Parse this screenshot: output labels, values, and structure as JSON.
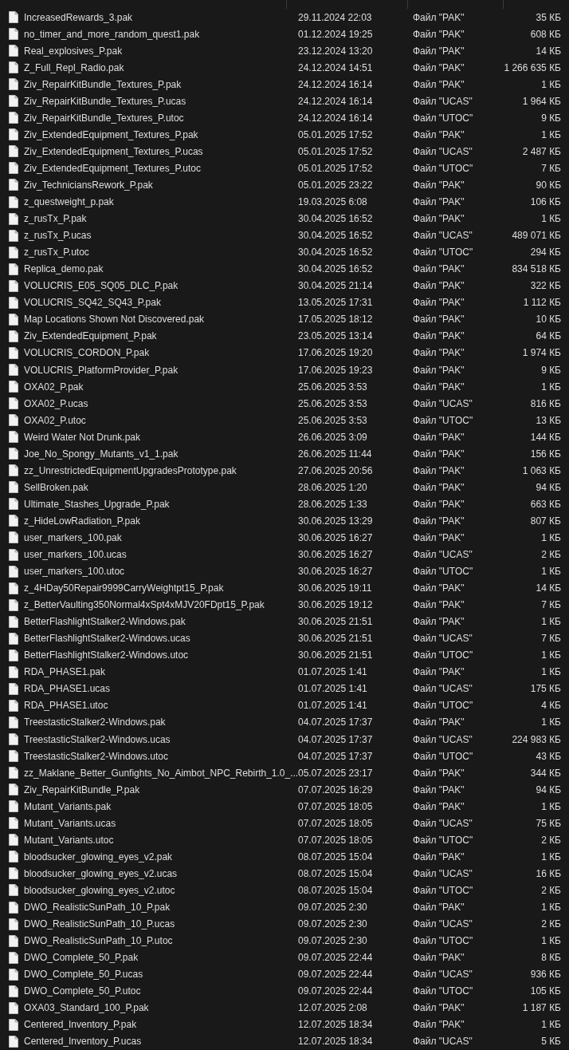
{
  "files": [
    {
      "name": "IncreasedRewards_3.pak",
      "modified": "29.11.2024 22:03",
      "type": "Файл \"PAK\"",
      "size": "35 КБ"
    },
    {
      "name": "no_timer_and_more_random_quest1.pak",
      "modified": "01.12.2024 19:25",
      "type": "Файл \"PAK\"",
      "size": "608 КБ"
    },
    {
      "name": "Real_explosives_P.pak",
      "modified": "23.12.2024 13:20",
      "type": "Файл \"PAK\"",
      "size": "14 КБ"
    },
    {
      "name": "Z_Full_Repl_Radio.pak",
      "modified": "24.12.2024 14:51",
      "type": "Файл \"PAK\"",
      "size": "1 266 635 КБ"
    },
    {
      "name": "Ziv_RepairKitBundle_Textures_P.pak",
      "modified": "24.12.2024 16:14",
      "type": "Файл \"PAK\"",
      "size": "1 КБ"
    },
    {
      "name": "Ziv_RepairKitBundle_Textures_P.ucas",
      "modified": "24.12.2024 16:14",
      "type": "Файл \"UCAS\"",
      "size": "1 964 КБ"
    },
    {
      "name": "Ziv_RepairKitBundle_Textures_P.utoc",
      "modified": "24.12.2024 16:14",
      "type": "Файл \"UTOC\"",
      "size": "9 КБ"
    },
    {
      "name": "Ziv_ExtendedEquipment_Textures_P.pak",
      "modified": "05.01.2025 17:52",
      "type": "Файл \"PAK\"",
      "size": "1 КБ"
    },
    {
      "name": "Ziv_ExtendedEquipment_Textures_P.ucas",
      "modified": "05.01.2025 17:52",
      "type": "Файл \"UCAS\"",
      "size": "2 487 КБ"
    },
    {
      "name": "Ziv_ExtendedEquipment_Textures_P.utoc",
      "modified": "05.01.2025 17:52",
      "type": "Файл \"UTOC\"",
      "size": "7 КБ"
    },
    {
      "name": "Ziv_TechniciansRework_P.pak",
      "modified": "05.01.2025 23:22",
      "type": "Файл \"PAK\"",
      "size": "90 КБ"
    },
    {
      "name": "z_questweight_p.pak",
      "modified": "19.03.2025 6:08",
      "type": "Файл \"PAK\"",
      "size": "106 КБ"
    },
    {
      "name": "z_rusTx_P.pak",
      "modified": "30.04.2025 16:52",
      "type": "Файл \"PAK\"",
      "size": "1 КБ"
    },
    {
      "name": "z_rusTx_P.ucas",
      "modified": "30.04.2025 16:52",
      "type": "Файл \"UCAS\"",
      "size": "489 071 КБ"
    },
    {
      "name": "z_rusTx_P.utoc",
      "modified": "30.04.2025 16:52",
      "type": "Файл \"UTOC\"",
      "size": "294 КБ"
    },
    {
      "name": "Replica_demo.pak",
      "modified": "30.04.2025 16:52",
      "type": "Файл \"PAK\"",
      "size": "834 518 КБ"
    },
    {
      "name": "VOLUCRIS_E05_SQ05_DLC_P.pak",
      "modified": "30.04.2025 21:14",
      "type": "Файл \"PAK\"",
      "size": "322 КБ"
    },
    {
      "name": "VOLUCRIS_SQ42_SQ43_P.pak",
      "modified": "13.05.2025 17:31",
      "type": "Файл \"PAK\"",
      "size": "1 112 КБ"
    },
    {
      "name": "Map Locations Shown Not Discovered.pak",
      "modified": "17.05.2025 18:12",
      "type": "Файл \"PAK\"",
      "size": "10 КБ"
    },
    {
      "name": "Ziv_ExtendedEquipment_P.pak",
      "modified": "23.05.2025 13:14",
      "type": "Файл \"PAK\"",
      "size": "64 КБ"
    },
    {
      "name": "VOLUCRIS_CORDON_P.pak",
      "modified": "17.06.2025 19:20",
      "type": "Файл \"PAK\"",
      "size": "1 974 КБ"
    },
    {
      "name": "VOLUCRIS_PlatformProvider_P.pak",
      "modified": "17.06.2025 19:23",
      "type": "Файл \"PAK\"",
      "size": "9 КБ"
    },
    {
      "name": "OXA02_P.pak",
      "modified": "25.06.2025 3:53",
      "type": "Файл \"PAK\"",
      "size": "1 КБ"
    },
    {
      "name": "OXA02_P.ucas",
      "modified": "25.06.2025 3:53",
      "type": "Файл \"UCAS\"",
      "size": "816 КБ"
    },
    {
      "name": "OXA02_P.utoc",
      "modified": "25.06.2025 3:53",
      "type": "Файл \"UTOC\"",
      "size": "13 КБ"
    },
    {
      "name": "Weird Water Not Drunk.pak",
      "modified": "26.06.2025 3:09",
      "type": "Файл \"PAK\"",
      "size": "144 КБ"
    },
    {
      "name": "Joe_No_Spongy_Mutants_v1_1.pak",
      "modified": "26.06.2025 11:44",
      "type": "Файл \"PAK\"",
      "size": "156 КБ"
    },
    {
      "name": "zz_UnrestrictedEquipmentUpgradesPrototype.pak",
      "modified": "27.06.2025 20:56",
      "type": "Файл \"PAK\"",
      "size": "1 063 КБ"
    },
    {
      "name": "SellBroken.pak",
      "modified": "28.06.2025 1:20",
      "type": "Файл \"PAK\"",
      "size": "94 КБ"
    },
    {
      "name": "Ultimate_Stashes_Upgrade_P.pak",
      "modified": "28.06.2025 1:33",
      "type": "Файл \"PAK\"",
      "size": "663 КБ"
    },
    {
      "name": "z_HideLowRadiation_P.pak",
      "modified": "30.06.2025 13:29",
      "type": "Файл \"PAK\"",
      "size": "807 КБ"
    },
    {
      "name": "user_markers_100.pak",
      "modified": "30.06.2025 16:27",
      "type": "Файл \"PAK\"",
      "size": "1 КБ"
    },
    {
      "name": "user_markers_100.ucas",
      "modified": "30.06.2025 16:27",
      "type": "Файл \"UCAS\"",
      "size": "2 КБ"
    },
    {
      "name": "user_markers_100.utoc",
      "modified": "30.06.2025 16:27",
      "type": "Файл \"UTOC\"",
      "size": "1 КБ"
    },
    {
      "name": "z_4HDay50Repair9999CarryWeightpt15_P.pak",
      "modified": "30.06.2025 19:11",
      "type": "Файл \"PAK\"",
      "size": "14 КБ"
    },
    {
      "name": "z_BetterVaulting350Normal4xSpt4xMJV20FDpt15_P.pak",
      "modified": "30.06.2025 19:12",
      "type": "Файл \"PAK\"",
      "size": "7 КБ"
    },
    {
      "name": "BetterFlashlightStalker2-Windows.pak",
      "modified": "30.06.2025 21:51",
      "type": "Файл \"PAK\"",
      "size": "1 КБ"
    },
    {
      "name": "BetterFlashlightStalker2-Windows.ucas",
      "modified": "30.06.2025 21:51",
      "type": "Файл \"UCAS\"",
      "size": "7 КБ"
    },
    {
      "name": "BetterFlashlightStalker2-Windows.utoc",
      "modified": "30.06.2025 21:51",
      "type": "Файл \"UTOC\"",
      "size": "1 КБ"
    },
    {
      "name": "RDA_PHASE1.pak",
      "modified": "01.07.2025 1:41",
      "type": "Файл \"PAK\"",
      "size": "1 КБ"
    },
    {
      "name": "RDA_PHASE1.ucas",
      "modified": "01.07.2025 1:41",
      "type": "Файл \"UCAS\"",
      "size": "175 КБ"
    },
    {
      "name": "RDA_PHASE1.utoc",
      "modified": "01.07.2025 1:41",
      "type": "Файл \"UTOC\"",
      "size": "4 КБ"
    },
    {
      "name": "TreestasticStalker2-Windows.pak",
      "modified": "04.07.2025 17:37",
      "type": "Файл \"PAK\"",
      "size": "1 КБ"
    },
    {
      "name": "TreestasticStalker2-Windows.ucas",
      "modified": "04.07.2025 17:37",
      "type": "Файл \"UCAS\"",
      "size": "224 983 КБ"
    },
    {
      "name": "TreestasticStalker2-Windows.utoc",
      "modified": "04.07.2025 17:37",
      "type": "Файл \"UTOC\"",
      "size": "43 КБ"
    },
    {
      "name": "zz_Maklane_Better_Gunfights_No_Aimbot_NPC_Rebirth_1.0_...",
      "modified": "05.07.2025 23:17",
      "type": "Файл \"PAK\"",
      "size": "344 КБ"
    },
    {
      "name": "Ziv_RepairKitBundle_P.pak",
      "modified": "07.07.2025 16:29",
      "type": "Файл \"PAK\"",
      "size": "94 КБ"
    },
    {
      "name": "Mutant_Variants.pak",
      "modified": "07.07.2025 18:05",
      "type": "Файл \"PAK\"",
      "size": "1 КБ"
    },
    {
      "name": "Mutant_Variants.ucas",
      "modified": "07.07.2025 18:05",
      "type": "Файл \"UCAS\"",
      "size": "75 КБ"
    },
    {
      "name": "Mutant_Variants.utoc",
      "modified": "07.07.2025 18:05",
      "type": "Файл \"UTOC\"",
      "size": "2 КБ"
    },
    {
      "name": "bloodsucker_glowing_eyes_v2.pak",
      "modified": "08.07.2025 15:04",
      "type": "Файл \"PAK\"",
      "size": "1 КБ"
    },
    {
      "name": "bloodsucker_glowing_eyes_v2.ucas",
      "modified": "08.07.2025 15:04",
      "type": "Файл \"UCAS\"",
      "size": "16 КБ"
    },
    {
      "name": "bloodsucker_glowing_eyes_v2.utoc",
      "modified": "08.07.2025 15:04",
      "type": "Файл \"UTOC\"",
      "size": "2 КБ"
    },
    {
      "name": "DWO_RealisticSunPath_10_P.pak",
      "modified": "09.07.2025 2:30",
      "type": "Файл \"PAK\"",
      "size": "1 КБ"
    },
    {
      "name": "DWO_RealisticSunPath_10_P.ucas",
      "modified": "09.07.2025 2:30",
      "type": "Файл \"UCAS\"",
      "size": "2 КБ"
    },
    {
      "name": "DWO_RealisticSunPath_10_P.utoc",
      "modified": "09.07.2025 2:30",
      "type": "Файл \"UTOC\"",
      "size": "1 КБ"
    },
    {
      "name": "DWO_Complete_50_P.pak",
      "modified": "09.07.2025 22:44",
      "type": "Файл \"PAK\"",
      "size": "8 КБ"
    },
    {
      "name": "DWO_Complete_50_P.ucas",
      "modified": "09.07.2025 22:44",
      "type": "Файл \"UCAS\"",
      "size": "936 КБ"
    },
    {
      "name": "DWO_Complete_50_P.utoc",
      "modified": "09.07.2025 22:44",
      "type": "Файл \"UTOC\"",
      "size": "105 КБ"
    },
    {
      "name": "OXA03_Standard_100_P.pak",
      "modified": "12.07.2025 2:08",
      "type": "Файл \"PAK\"",
      "size": "1 187 КБ"
    },
    {
      "name": "Centered_Inventory_P.pak",
      "modified": "12.07.2025 18:34",
      "type": "Файл \"PAK\"",
      "size": "1 КБ"
    },
    {
      "name": "Centered_Inventory_P.ucas",
      "modified": "12.07.2025 18:34",
      "type": "Файл \"UCAS\"",
      "size": "5 КБ"
    }
  ]
}
